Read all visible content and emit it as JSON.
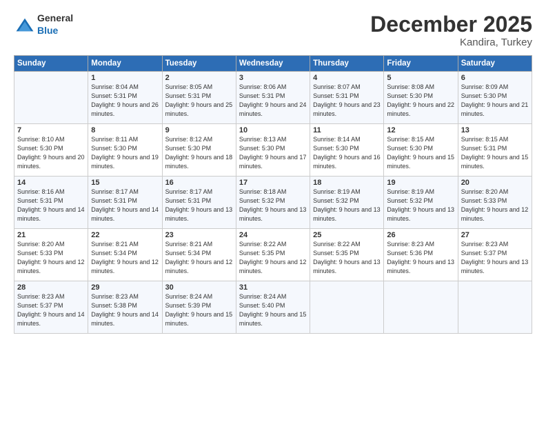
{
  "header": {
    "logo_general": "General",
    "logo_blue": "Blue",
    "month": "December 2025",
    "location": "Kandira, Turkey"
  },
  "weekdays": [
    "Sunday",
    "Monday",
    "Tuesday",
    "Wednesday",
    "Thursday",
    "Friday",
    "Saturday"
  ],
  "weeks": [
    [
      {
        "day": "",
        "info": ""
      },
      {
        "day": "1",
        "info": "Sunrise: 8:04 AM\nSunset: 5:31 PM\nDaylight: 9 hours\nand 26 minutes."
      },
      {
        "day": "2",
        "info": "Sunrise: 8:05 AM\nSunset: 5:31 PM\nDaylight: 9 hours\nand 25 minutes."
      },
      {
        "day": "3",
        "info": "Sunrise: 8:06 AM\nSunset: 5:31 PM\nDaylight: 9 hours\nand 24 minutes."
      },
      {
        "day": "4",
        "info": "Sunrise: 8:07 AM\nSunset: 5:31 PM\nDaylight: 9 hours\nand 23 minutes."
      },
      {
        "day": "5",
        "info": "Sunrise: 8:08 AM\nSunset: 5:30 PM\nDaylight: 9 hours\nand 22 minutes."
      },
      {
        "day": "6",
        "info": "Sunrise: 8:09 AM\nSunset: 5:30 PM\nDaylight: 9 hours\nand 21 minutes."
      }
    ],
    [
      {
        "day": "7",
        "info": "Sunrise: 8:10 AM\nSunset: 5:30 PM\nDaylight: 9 hours\nand 20 minutes."
      },
      {
        "day": "8",
        "info": "Sunrise: 8:11 AM\nSunset: 5:30 PM\nDaylight: 9 hours\nand 19 minutes."
      },
      {
        "day": "9",
        "info": "Sunrise: 8:12 AM\nSunset: 5:30 PM\nDaylight: 9 hours\nand 18 minutes."
      },
      {
        "day": "10",
        "info": "Sunrise: 8:13 AM\nSunset: 5:30 PM\nDaylight: 9 hours\nand 17 minutes."
      },
      {
        "day": "11",
        "info": "Sunrise: 8:14 AM\nSunset: 5:30 PM\nDaylight: 9 hours\nand 16 minutes."
      },
      {
        "day": "12",
        "info": "Sunrise: 8:15 AM\nSunset: 5:30 PM\nDaylight: 9 hours\nand 15 minutes."
      },
      {
        "day": "13",
        "info": "Sunrise: 8:15 AM\nSunset: 5:31 PM\nDaylight: 9 hours\nand 15 minutes."
      }
    ],
    [
      {
        "day": "14",
        "info": "Sunrise: 8:16 AM\nSunset: 5:31 PM\nDaylight: 9 hours\nand 14 minutes."
      },
      {
        "day": "15",
        "info": "Sunrise: 8:17 AM\nSunset: 5:31 PM\nDaylight: 9 hours\nand 14 minutes."
      },
      {
        "day": "16",
        "info": "Sunrise: 8:17 AM\nSunset: 5:31 PM\nDaylight: 9 hours\nand 13 minutes."
      },
      {
        "day": "17",
        "info": "Sunrise: 8:18 AM\nSunset: 5:32 PM\nDaylight: 9 hours\nand 13 minutes."
      },
      {
        "day": "18",
        "info": "Sunrise: 8:19 AM\nSunset: 5:32 PM\nDaylight: 9 hours\nand 13 minutes."
      },
      {
        "day": "19",
        "info": "Sunrise: 8:19 AM\nSunset: 5:32 PM\nDaylight: 9 hours\nand 13 minutes."
      },
      {
        "day": "20",
        "info": "Sunrise: 8:20 AM\nSunset: 5:33 PM\nDaylight: 9 hours\nand 12 minutes."
      }
    ],
    [
      {
        "day": "21",
        "info": "Sunrise: 8:20 AM\nSunset: 5:33 PM\nDaylight: 9 hours\nand 12 minutes."
      },
      {
        "day": "22",
        "info": "Sunrise: 8:21 AM\nSunset: 5:34 PM\nDaylight: 9 hours\nand 12 minutes."
      },
      {
        "day": "23",
        "info": "Sunrise: 8:21 AM\nSunset: 5:34 PM\nDaylight: 9 hours\nand 12 minutes."
      },
      {
        "day": "24",
        "info": "Sunrise: 8:22 AM\nSunset: 5:35 PM\nDaylight: 9 hours\nand 12 minutes."
      },
      {
        "day": "25",
        "info": "Sunrise: 8:22 AM\nSunset: 5:35 PM\nDaylight: 9 hours\nand 13 minutes."
      },
      {
        "day": "26",
        "info": "Sunrise: 8:23 AM\nSunset: 5:36 PM\nDaylight: 9 hours\nand 13 minutes."
      },
      {
        "day": "27",
        "info": "Sunrise: 8:23 AM\nSunset: 5:37 PM\nDaylight: 9 hours\nand 13 minutes."
      }
    ],
    [
      {
        "day": "28",
        "info": "Sunrise: 8:23 AM\nSunset: 5:37 PM\nDaylight: 9 hours\nand 14 minutes."
      },
      {
        "day": "29",
        "info": "Sunrise: 8:23 AM\nSunset: 5:38 PM\nDaylight: 9 hours\nand 14 minutes."
      },
      {
        "day": "30",
        "info": "Sunrise: 8:24 AM\nSunset: 5:39 PM\nDaylight: 9 hours\nand 15 minutes."
      },
      {
        "day": "31",
        "info": "Sunrise: 8:24 AM\nSunset: 5:40 PM\nDaylight: 9 hours\nand 15 minutes."
      },
      {
        "day": "",
        "info": ""
      },
      {
        "day": "",
        "info": ""
      },
      {
        "day": "",
        "info": ""
      }
    ]
  ]
}
